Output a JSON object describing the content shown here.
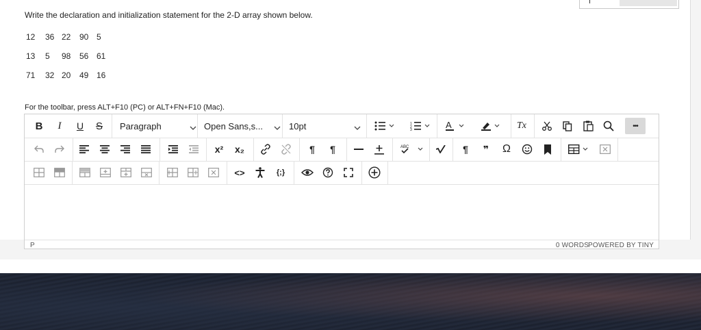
{
  "question": {
    "prompt": "Write the declaration and initialization statement for the 2-D array shown below."
  },
  "matrix": {
    "rows": [
      [
        "12",
        "36",
        "22",
        "90",
        "5"
      ],
      [
        "13",
        "5",
        "98",
        "56",
        "61"
      ],
      [
        "71",
        "32",
        "20",
        "49",
        "16"
      ]
    ]
  },
  "editor": {
    "toolbar_hint": "For the toolbar, press ALT+F10 (PC) or ALT+FN+F10 (Mac).",
    "format_block": "Paragraph",
    "font_family": "Open Sans,s...",
    "font_size": "10pt",
    "more_label": "•••",
    "status_path": "P",
    "word_count": "0 WORDS",
    "powered_by": "POWERED BY TINY",
    "icons": {
      "bold": "B",
      "italic": "I",
      "underline": "U",
      "strikethrough": "S",
      "superscript": "x²",
      "subscript": "x₂",
      "source_code": "<>",
      "code_sample": "{;}",
      "omega": "Ω",
      "pilcrow": "¶",
      "quote": "❞",
      "clear_format": "Tx"
    }
  },
  "colors": {
    "accent": "#222222",
    "more_bg": "#d9d9d9",
    "border": "#cfcfcf"
  }
}
